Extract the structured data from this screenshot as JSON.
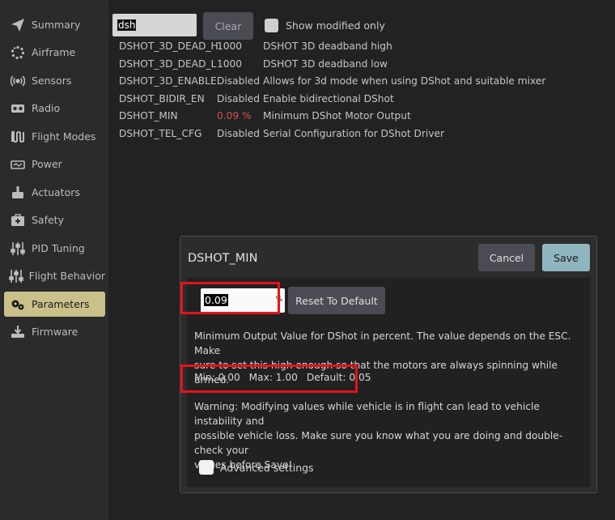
{
  "sidebar": {
    "items": [
      {
        "label": "Summary",
        "icon": "paper-plane-icon"
      },
      {
        "label": "Airframe",
        "icon": "airframe-dots-icon"
      },
      {
        "label": "Sensors",
        "icon": "sensors-signal-icon"
      },
      {
        "label": "Radio",
        "icon": "radio-controller-icon"
      },
      {
        "label": "Flight Modes",
        "icon": "flight-modes-wave-icon"
      },
      {
        "label": "Power",
        "icon": "battery-icon"
      },
      {
        "label": "Actuators",
        "icon": "actuator-icon"
      },
      {
        "label": "Safety",
        "icon": "first-aid-icon"
      },
      {
        "label": "PID Tuning",
        "icon": "sliders-icon"
      },
      {
        "label": "Flight Behavior",
        "icon": "sliders-icon"
      },
      {
        "label": "Parameters",
        "icon": "gears-icon"
      },
      {
        "label": "Firmware",
        "icon": "firmware-download-icon"
      }
    ],
    "active_index": 10,
    "active_color": "#c9c08a"
  },
  "filter": {
    "search_value": "dsh",
    "clear_label": "Clear",
    "show_modified_label": "Show modified only",
    "show_modified_checked": false
  },
  "params": [
    {
      "name": "DSHOT_3D_DEAD_H",
      "value": "1000",
      "desc": "DSHOT 3D deadband high",
      "modified": false
    },
    {
      "name": "DSHOT_3D_DEAD_L",
      "value": "1000",
      "desc": "DSHOT 3D deadband low",
      "modified": false
    },
    {
      "name": "DSHOT_3D_ENABLE",
      "value": "Disabled",
      "desc": "Allows for 3d mode when using DShot and suitable mixer",
      "modified": false
    },
    {
      "name": "DSHOT_BIDIR_EN",
      "value": "Disabled",
      "desc": "Enable bidirectional DShot",
      "modified": false
    },
    {
      "name": "DSHOT_MIN",
      "value": "0.09 %",
      "desc": "Minimum DShot Motor Output",
      "modified": true
    },
    {
      "name": "DSHOT_TEL_CFG",
      "value": "Disabled",
      "desc": "Serial Configuration for DShot Driver",
      "modified": false
    }
  ],
  "dialog": {
    "title": "DSHOT_MIN",
    "cancel_label": "Cancel",
    "save_label": "Save",
    "value": "0.09",
    "unit": "%",
    "reset_label": "Reset To Default",
    "description_line1": "Minimum Output Value for DShot in percent. The value depends on the ESC. Make",
    "description_line2": "sure to set this high enough so that the motors are always spinning while armed.",
    "min_text": "Min: 0.00",
    "max_text": "Max: 1.00",
    "default_text": "Default: 0.05",
    "warning_line1": "Warning: Modifying values while vehicle is in flight can lead to vehicle instability and",
    "warning_line2": "possible vehicle loss. Make sure you know what you are doing and double-check your",
    "warning_line3": "values before Save!",
    "advanced_label": "Advanced settings",
    "advanced_checked": false
  },
  "colors": {
    "modified_value": "#d9534f",
    "highlight": "#e5121b",
    "save_button": "#8fb5c0"
  }
}
